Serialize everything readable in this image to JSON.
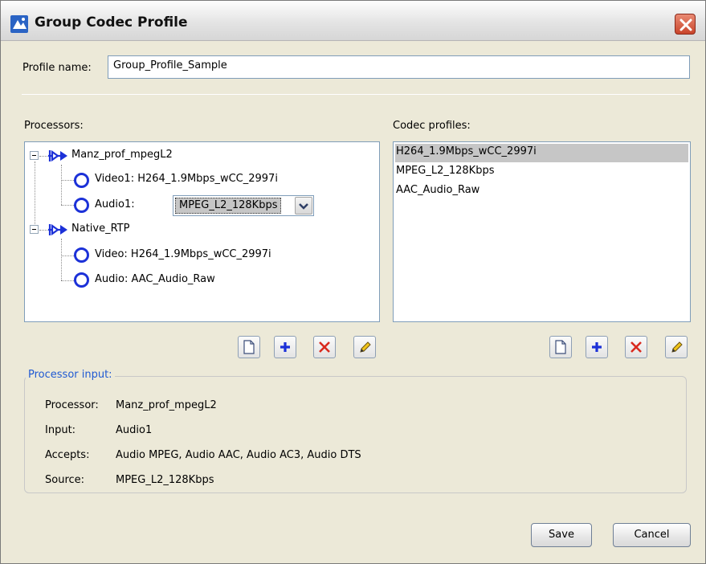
{
  "window": {
    "title": "Group Codec Profile"
  },
  "profile": {
    "label": "Profile name:",
    "value": "Group_Profile_Sample"
  },
  "processors": {
    "label": "Processors:",
    "tree": [
      {
        "name": "Manz_prof_mpegL2",
        "children": [
          {
            "text": "Video1: H264_1.9Mbps_wCC_2997i"
          },
          {
            "label": "Audio1:",
            "combo_value": "MPEG_L2_128Kbps"
          }
        ]
      },
      {
        "name": "Native_RTP",
        "children": [
          {
            "text": "Video: H264_1.9Mbps_wCC_2997i"
          },
          {
            "text": "Audio: AAC_Audio_Raw"
          }
        ]
      }
    ]
  },
  "codec_profiles": {
    "label": "Codec profiles:",
    "items": [
      "H264_1.9Mbps_wCC_2997i",
      "MPEG_L2_128Kbps",
      "AAC_Audio_Raw"
    ],
    "selected_index": 0
  },
  "processor_input": {
    "title": "Processor input:",
    "rows": [
      {
        "label": "Processor:",
        "value": "Manz_prof_mpegL2"
      },
      {
        "label": "Input:",
        "value": "Audio1"
      },
      {
        "label": "Accepts:",
        "value": "Audio MPEG, Audio AAC, Audio AC3, Audio DTS"
      },
      {
        "label": "Source:",
        "value": "MPEG_L2_128Kbps"
      }
    ]
  },
  "buttons": {
    "save": "Save",
    "cancel": "Cancel"
  },
  "icons": {
    "title": "app-icon",
    "close": "close-icon",
    "toolbar": [
      "new-document-icon",
      "add-icon",
      "delete-icon",
      "edit-icon"
    ]
  },
  "colors": {
    "accent_blue": "#1c31d8",
    "group_title": "#1f59d2",
    "close_red": "#c9442a",
    "selection_gray": "#c6c6c6"
  }
}
